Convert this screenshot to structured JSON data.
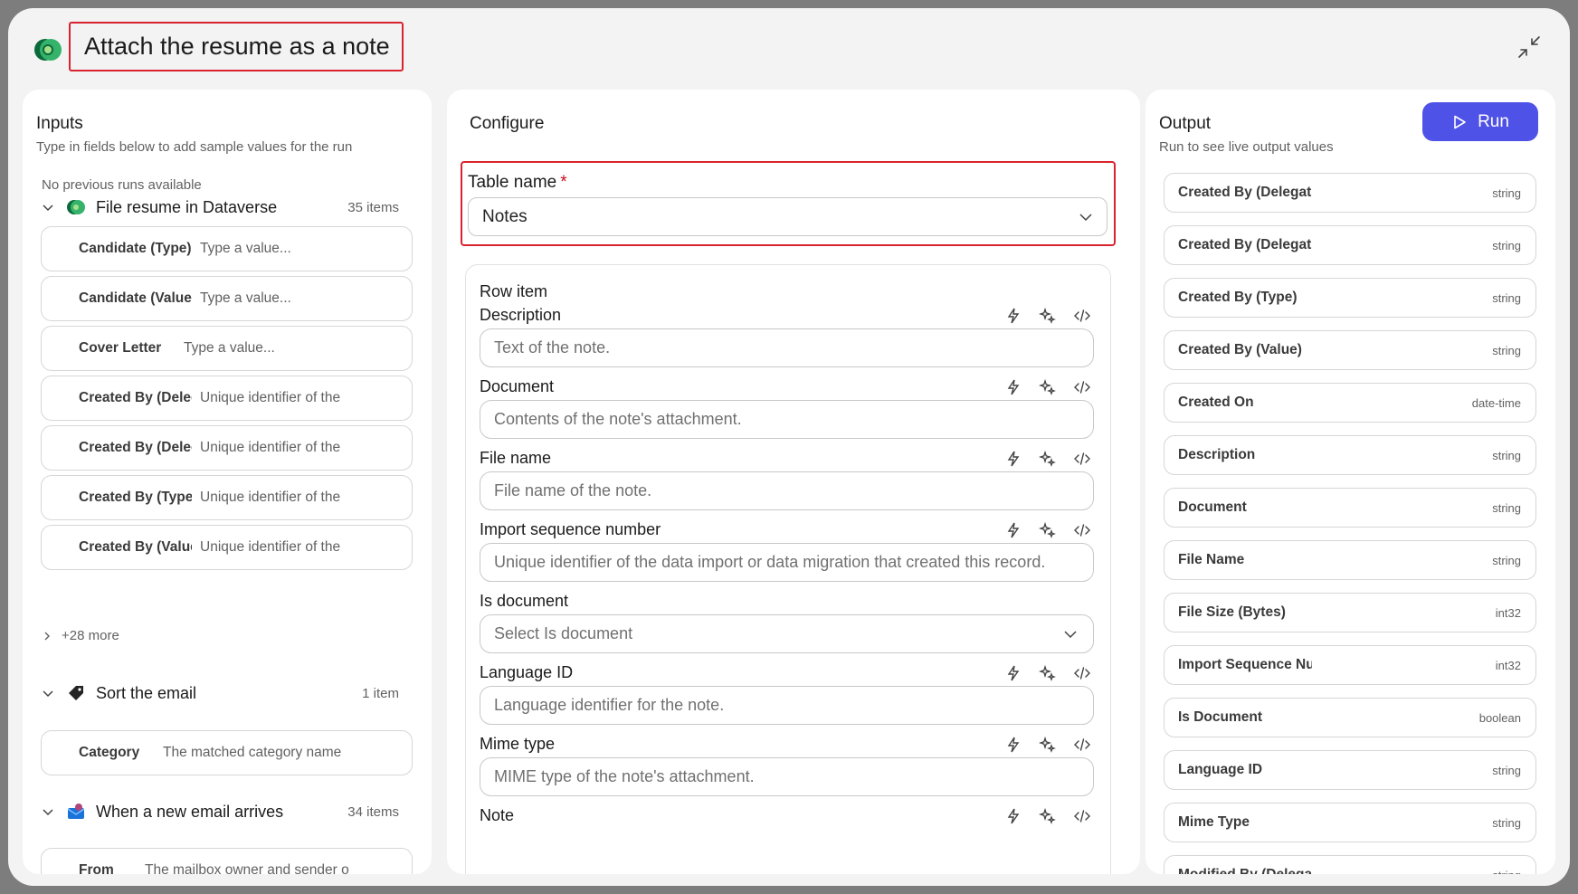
{
  "title": "Attach the resume as a note",
  "inputs": {
    "title": "Inputs",
    "subtitle": "Type in fields below to add sample values for the run",
    "no_runs": "No previous runs available",
    "groups": [
      {
        "name": "File resume in Dataverse",
        "count": "35 items",
        "icon": "dataverse-icon",
        "fields": [
          {
            "label": "Candidate (Type)",
            "placeholder": "Type a value..."
          },
          {
            "label": "Candidate (Value",
            "placeholder": "Type a value..."
          },
          {
            "label": "Cover Letter",
            "placeholder": "Type a value..."
          },
          {
            "label": "Created By (Deleg",
            "placeholder": "Unique identifier of the"
          },
          {
            "label": "Created By (Deleg",
            "placeholder": "Unique identifier of the"
          },
          {
            "label": "Created By (Type",
            "placeholder": "Unique identifier of the"
          },
          {
            "label": "Created By (Value",
            "placeholder": "Unique identifier of the"
          }
        ],
        "more": "+28 more"
      },
      {
        "name": "Sort the email",
        "count": "1 item",
        "icon": "tag-icon",
        "fields": [
          {
            "label": "Category",
            "placeholder": "The matched category name"
          }
        ]
      },
      {
        "name": "When a new email arrives",
        "count": "34 items",
        "icon": "outlook-icon",
        "fields": [
          {
            "label": "From",
            "placeholder": "The mailbox owner and sender o"
          }
        ]
      }
    ]
  },
  "configure": {
    "title": "Configure",
    "table_name_label": "Table name",
    "required_mark": "*",
    "table_name_value": "Notes",
    "row_item_title": "Row item",
    "fields": [
      {
        "label": "Description",
        "placeholder": "Text of the note."
      },
      {
        "label": "Document",
        "placeholder": "Contents of the note's attachment."
      },
      {
        "label": "File name",
        "placeholder": "File name of the note."
      },
      {
        "label": "Import sequence number",
        "placeholder": "Unique identifier of the data import or data migration that created this record."
      },
      {
        "label": "Is document",
        "placeholder": "Select Is document"
      },
      {
        "label": "Language ID",
        "placeholder": "Language identifier for the note."
      },
      {
        "label": "Mime type",
        "placeholder": "MIME type of the note's attachment."
      },
      {
        "label": "Note",
        "placeholder": ""
      }
    ]
  },
  "output": {
    "title": "Output",
    "subtitle": "Run to see live output values",
    "run_label": "Run",
    "fields": [
      {
        "label": "Created By (Delegat",
        "type": "string"
      },
      {
        "label": "Created By (Delegat",
        "type": "string"
      },
      {
        "label": "Created By (Type)",
        "type": "string"
      },
      {
        "label": "Created By (Value)",
        "type": "string"
      },
      {
        "label": "Created On",
        "type": "date-time"
      },
      {
        "label": "Description",
        "type": "string"
      },
      {
        "label": "Document",
        "type": "string"
      },
      {
        "label": "File Name",
        "type": "string"
      },
      {
        "label": "File Size (Bytes)",
        "type": "int32"
      },
      {
        "label": "Import Sequence Nu",
        "type": "int32"
      },
      {
        "label": "Is Document",
        "type": "boolean"
      },
      {
        "label": "Language ID",
        "type": "string"
      },
      {
        "label": "Mime Type",
        "type": "string"
      },
      {
        "label": "Modified By (Delega",
        "type": "string"
      }
    ]
  },
  "colors": {
    "accent": "#4f52e6",
    "highlight_border": "#d9232e",
    "required": "#c50f1f"
  }
}
